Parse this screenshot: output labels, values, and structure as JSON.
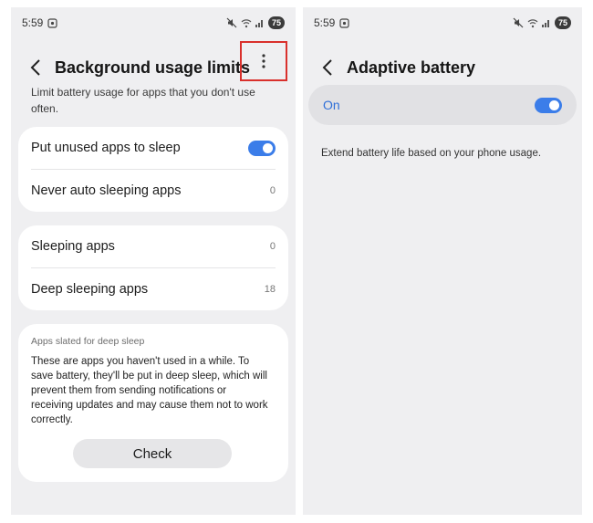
{
  "colors": {
    "accent": "#3b7de9",
    "highlight_box": "#d9302c"
  },
  "status_bar": {
    "time": "5:59",
    "battery": "75",
    "icons": [
      "screenshot-icon",
      "mute-icon",
      "wifi-icon",
      "signal-icon",
      "battery-icon"
    ]
  },
  "left_screen": {
    "title": "Background usage limits",
    "description": "Limit battery usage for apps that you don't use often.",
    "settings_group": [
      {
        "label": "Put unused apps to sleep",
        "toggle_on": true
      },
      {
        "label": "Never auto sleeping apps",
        "count": "0"
      }
    ],
    "apps_group": [
      {
        "label": "Sleeping apps",
        "count": "0"
      },
      {
        "label": "Deep sleeping apps",
        "count": "18"
      }
    ],
    "info_card": {
      "heading": "Apps slated for deep sleep",
      "text": "These are apps you haven't used in a while. To save battery, they'll be put in deep sleep, which will prevent them from sending notifications or receiving updates and may cause them not to work correctly.",
      "button": "Check"
    }
  },
  "right_screen": {
    "title": "Adaptive battery",
    "switch_label": "On",
    "switch_on": true,
    "description": "Extend battery life based on your phone usage."
  }
}
